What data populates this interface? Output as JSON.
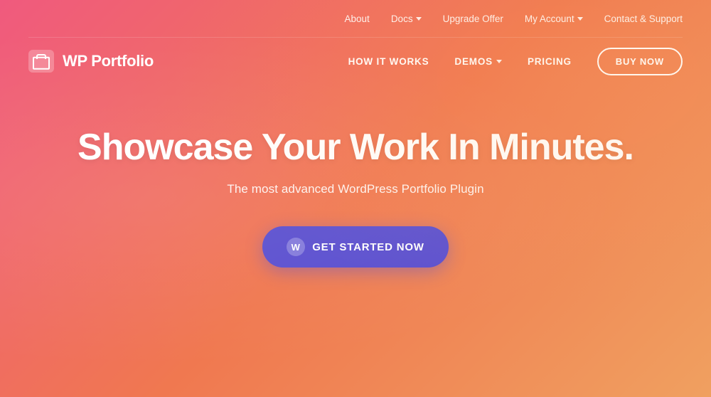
{
  "topbar": {
    "links": [
      {
        "label": "About",
        "id": "about",
        "has_dropdown": false
      },
      {
        "label": "Docs",
        "id": "docs",
        "has_dropdown": true
      },
      {
        "label": "Upgrade Offer",
        "id": "upgrade-offer",
        "has_dropdown": false
      },
      {
        "label": "My Account",
        "id": "my-account",
        "has_dropdown": true
      },
      {
        "label": "Contact & Support",
        "id": "contact-support",
        "has_dropdown": false
      }
    ]
  },
  "logo": {
    "text": "WP Portfolio"
  },
  "mainnav": {
    "links": [
      {
        "label": "HOW IT WORKS",
        "id": "how-it-works",
        "has_dropdown": false
      },
      {
        "label": "DEMOS",
        "id": "demos",
        "has_dropdown": true
      },
      {
        "label": "PRICING",
        "id": "pricing",
        "has_dropdown": false
      }
    ],
    "cta_label": "BUY NOW"
  },
  "hero": {
    "title": "Showcase Your Work In Minutes.",
    "subtitle": "The most advanced WordPress Portfolio Plugin",
    "cta_label": "GET STARTED NOW",
    "wp_icon_label": "W"
  },
  "colors": {
    "accent_purple": "#5b4fcf",
    "text_white": "#ffffff"
  }
}
